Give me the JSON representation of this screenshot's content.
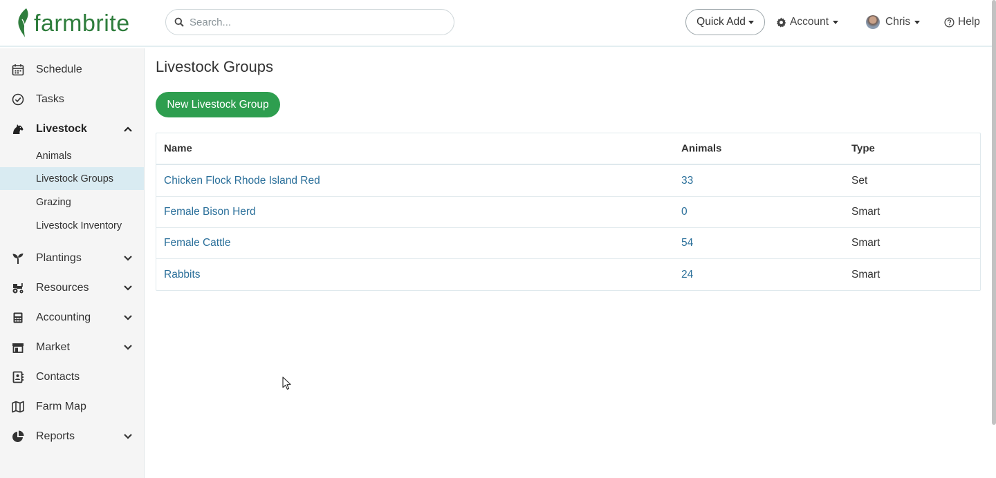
{
  "header": {
    "brand": "farmbrite",
    "search_placeholder": "Search...",
    "quick_add": "Quick Add",
    "account": "Account",
    "user": "Chris",
    "help": "Help"
  },
  "sidebar": {
    "items": [
      {
        "label": "Schedule",
        "icon": "calendar-icon"
      },
      {
        "label": "Tasks",
        "icon": "check-circle-icon"
      },
      {
        "label": "Livestock",
        "icon": "horse-icon",
        "expanded": true
      },
      {
        "label": "Plantings",
        "icon": "seedling-icon"
      },
      {
        "label": "Resources",
        "icon": "tractor-icon"
      },
      {
        "label": "Accounting",
        "icon": "calculator-icon"
      },
      {
        "label": "Market",
        "icon": "store-icon"
      },
      {
        "label": "Contacts",
        "icon": "address-book-icon"
      },
      {
        "label": "Farm Map",
        "icon": "map-icon"
      },
      {
        "label": "Reports",
        "icon": "pie-chart-icon"
      }
    ],
    "livestock_sub": [
      "Animals",
      "Livestock Groups",
      "Grazing",
      "Livestock Inventory"
    ],
    "active_sub": "Livestock Groups"
  },
  "main": {
    "title": "Livestock Groups",
    "new_button": "New Livestock Group",
    "columns": [
      "Name",
      "Animals",
      "Type"
    ],
    "rows": [
      {
        "name": "Chicken Flock Rhode Island Red",
        "animals": "33",
        "type": "Set"
      },
      {
        "name": "Female Bison Herd",
        "animals": "0",
        "type": "Smart"
      },
      {
        "name": "Female Cattle",
        "animals": "54",
        "type": "Smart"
      },
      {
        "name": "Rabbits",
        "animals": "24",
        "type": "Smart"
      }
    ]
  },
  "colors": {
    "brand_green": "#2e7d3c",
    "button_green": "#2e9e4f",
    "link_blue": "#2a6f9a",
    "active_bg": "#d9ebf2"
  }
}
